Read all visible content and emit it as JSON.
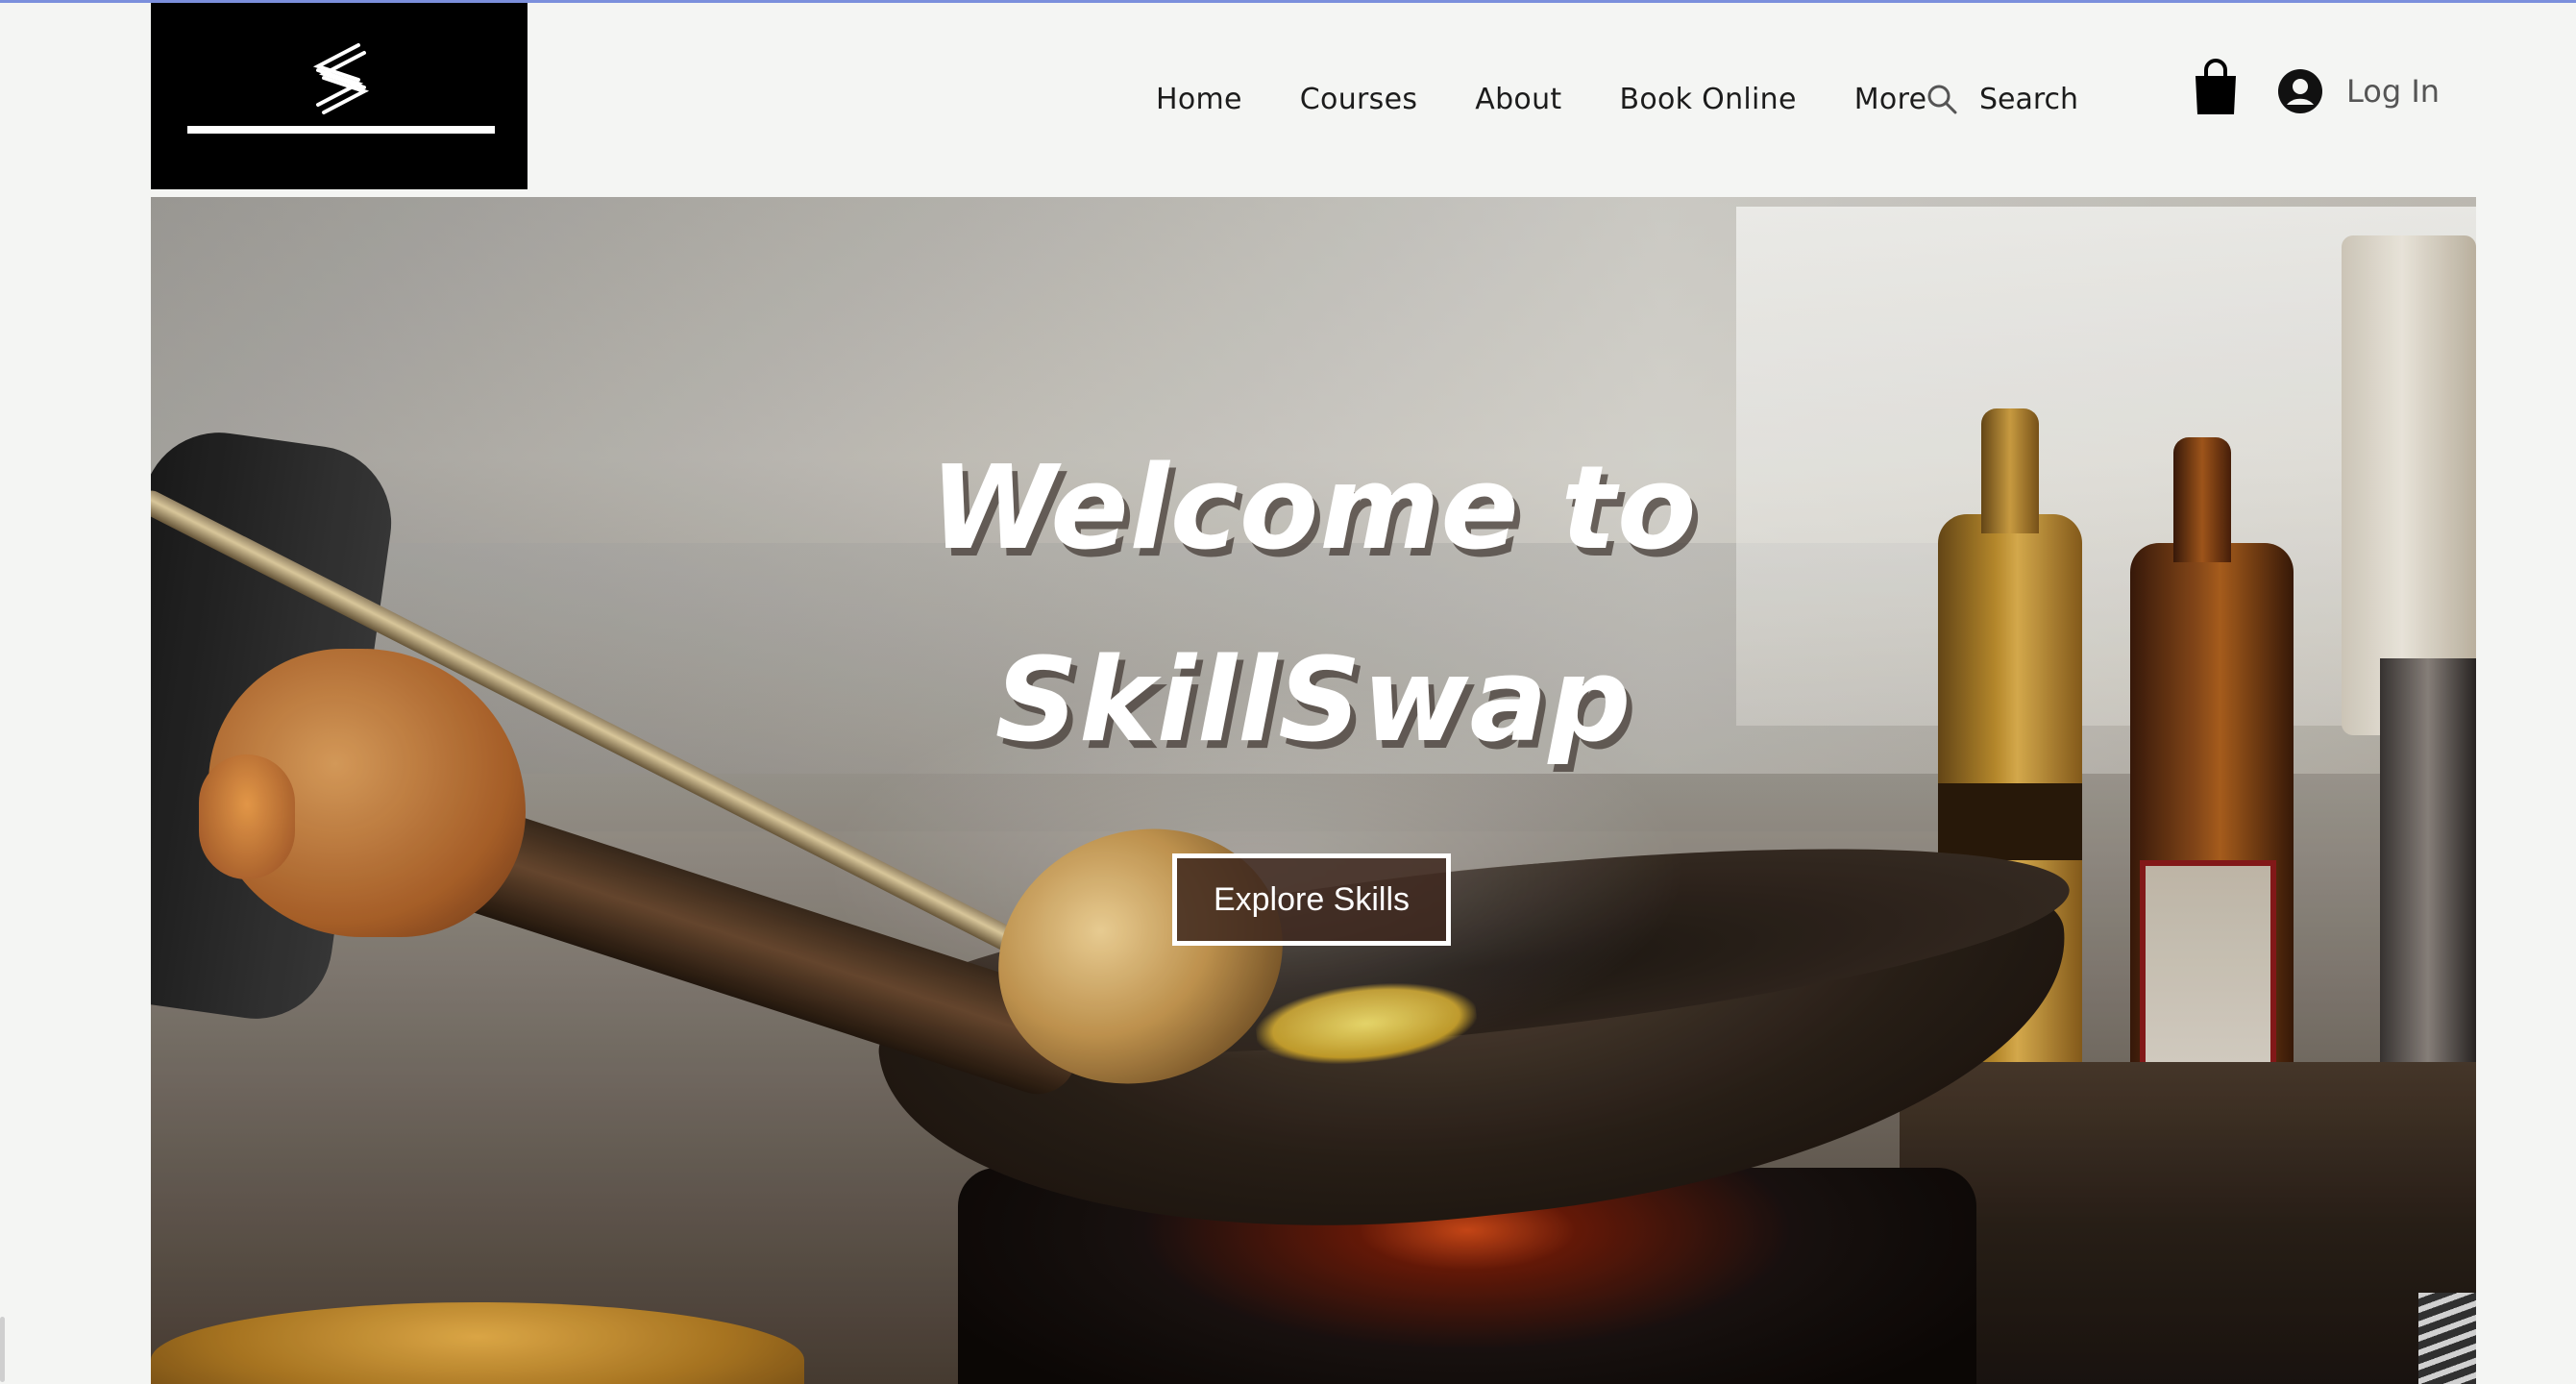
{
  "header": {
    "logo_name": "SkillSwap logo",
    "nav": [
      {
        "label": "Home"
      },
      {
        "label": "Courses"
      },
      {
        "label": "About"
      },
      {
        "label": "Book Online"
      },
      {
        "label": "More"
      }
    ],
    "search_label": "Search",
    "login_label": "Log In"
  },
  "hero": {
    "title_line1": "Welcome to",
    "title_line2": "SkillSwap",
    "cta_label": "Explore Skills"
  },
  "icons": {
    "search": "search-icon",
    "cart": "shopping-bag-icon",
    "account": "user-avatar-icon"
  },
  "colors": {
    "logo_background": "#000000",
    "page_background": "#f4f5f3",
    "nav_text": "#1c1c1c",
    "hero_title": "#ffffff",
    "cta_border": "#ffffff"
  }
}
